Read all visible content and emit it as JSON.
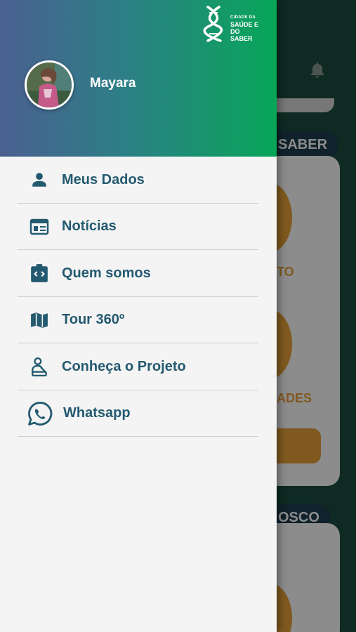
{
  "drawer": {
    "logo": {
      "line1": "CIDADE DA",
      "line2": "SAÚDE E",
      "line3": "DO SABER"
    },
    "user": {
      "name": "Mayara"
    },
    "menu": [
      {
        "label": "Meus Dados",
        "icon": "person-icon"
      },
      {
        "label": "Notícias",
        "icon": "newspaper-icon"
      },
      {
        "label": "Quem somos",
        "icon": "code-badge-icon"
      },
      {
        "label": "Tour 360º",
        "icon": "map-icon"
      },
      {
        "label": "Conheça o Projeto",
        "icon": "presenter-icon"
      },
      {
        "label": "Whatsapp",
        "icon": "whatsapp-icon"
      }
    ]
  },
  "background": {
    "pill1": "SABER",
    "card1_text1": "TO",
    "card1_text2": "ADES",
    "pill2": "OSCO"
  },
  "colors": {
    "header_gradient_start": "#4b5f91",
    "header_gradient_end": "#07a658",
    "menu_text": "#245a70",
    "accent_orange": "#e8a33a",
    "bg_green": "#1b4d3e"
  }
}
